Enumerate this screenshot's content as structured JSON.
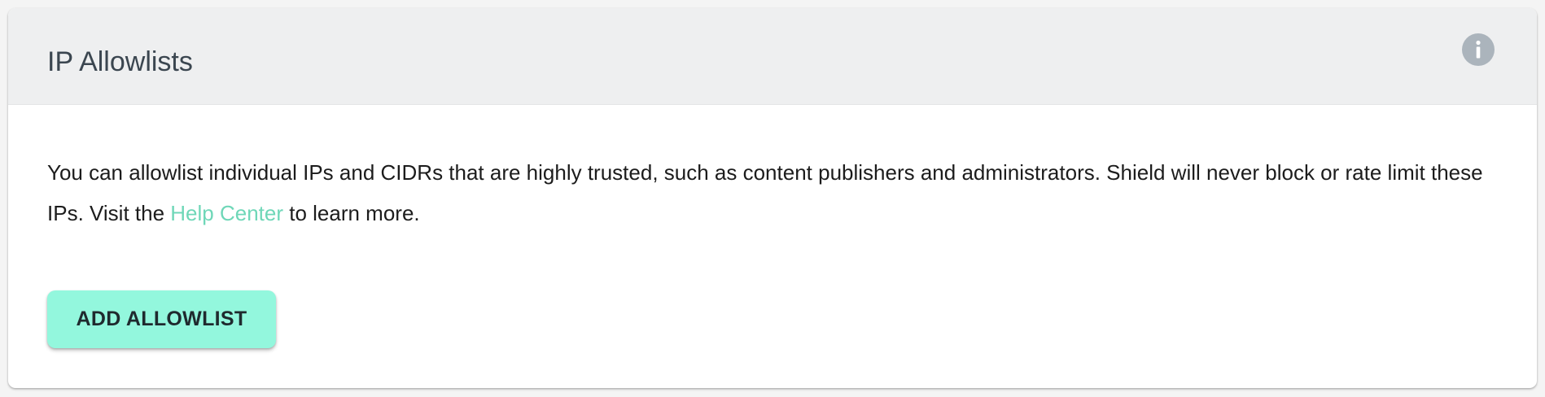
{
  "panel": {
    "title": "IP Allowlists",
    "info_icon": "info-icon"
  },
  "description": {
    "text_before": "You can allowlist individual IPs and CIDRs that are highly trusted, such as content publishers and administrators. Shield will never block or rate limit these IPs. Visit the ",
    "link_text": "Help Center",
    "text_after": " to learn more."
  },
  "actions": {
    "add_label": "ADD ALLOWLIST"
  },
  "colors": {
    "header_bg": "#eeeff0",
    "link": "#6fd7b8",
    "button_bg": "#93f7dd",
    "info_icon_bg": "#abb4bc"
  }
}
